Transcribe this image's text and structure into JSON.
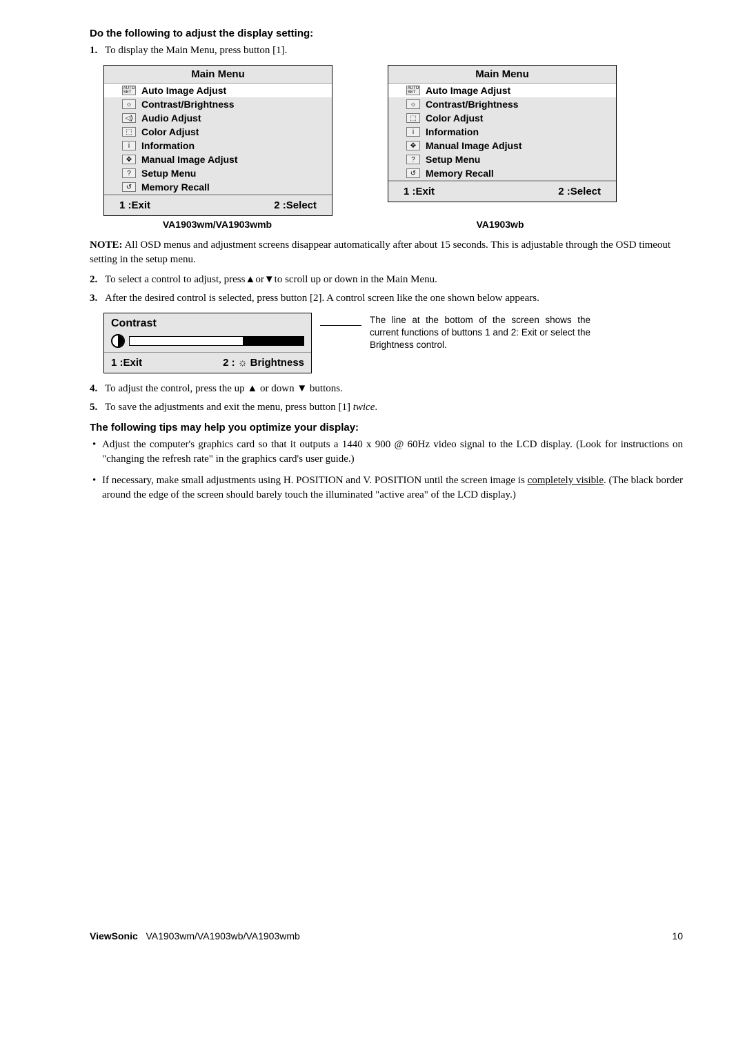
{
  "section1_title": "Do the following to adjust the display setting:",
  "step1": "To display the Main Menu, press button [1].",
  "left_menu": {
    "title": "Main Menu",
    "items": [
      {
        "icon": "AUTO SET",
        "label": "Auto Image Adjust",
        "selected": true
      },
      {
        "icon": "☼",
        "label": "Contrast/Brightness"
      },
      {
        "icon": "◁))",
        "label": "Audio Adjust"
      },
      {
        "icon": "⬚",
        "label": "Color Adjust"
      },
      {
        "icon": "i",
        "label": "Information"
      },
      {
        "icon": "✥",
        "label": "Manual Image Adjust"
      },
      {
        "icon": "?",
        "label": "Setup Menu"
      },
      {
        "icon": "↺",
        "label": "Memory Recall"
      }
    ],
    "footer_left": "1 :Exit",
    "footer_right": "2 :Select",
    "caption": "VA1903wm/VA1903wmb"
  },
  "right_menu": {
    "title": "Main Menu",
    "items": [
      {
        "icon": "AUTO SET",
        "label": "Auto Image Adjust",
        "selected": true
      },
      {
        "icon": "☼",
        "label": "Contrast/Brightness"
      },
      {
        "icon": "⬚",
        "label": "Color Adjust"
      },
      {
        "icon": "i",
        "label": "Information"
      },
      {
        "icon": "✥",
        "label": "Manual Image Adjust"
      },
      {
        "icon": "?",
        "label": "Setup Menu"
      },
      {
        "icon": "↺",
        "label": "Memory Recall"
      }
    ],
    "footer_left": "1 :Exit",
    "footer_right": "2 :Select",
    "caption": "VA1903wb"
  },
  "note_text": "All OSD menus and adjustment screens disappear automatically after about 15 seconds. This is adjustable through the OSD timeout setting in the setup menu.",
  "step2": "To select a control to adjust, press▲or▼to scroll up or down in the Main Menu.",
  "step3": "After the desired control is selected, press button [2]. A control screen like the one shown below appears.",
  "contrast": {
    "title": "Contrast",
    "footer_left": "1 :Exit",
    "footer_right": "2 : ☼ Brightness"
  },
  "side_note": "The line at the bottom of the screen shows the current functions of buttons 1 and 2: Exit or select the Brightness control.",
  "step4": "To adjust the control, press the up ▲ or down ▼ buttons.",
  "step5_pre": "To save the adjustments and exit the menu, press button [1] ",
  "step5_ital": "twice",
  "section2_title": "The following tips may help you optimize your display:",
  "tip1": "Adjust the computer's graphics card so that it outputs a 1440 x 900 @ 60Hz video signal to the LCD display. (Look for instructions on \"changing the refresh rate\" in the graphics card's user guide.)",
  "tip2_pre": "If necessary, make small adjustments using H. POSITION and V. POSITION until the screen image is ",
  "tip2_ul": "completely visible",
  "tip2_post": ". (The black border around the edge of the screen should barely touch the illuminated \"active area\" of the LCD display.)",
  "footer_brand": "ViewSonic",
  "footer_model": "VA1903wm/VA1903wb/VA1903wmb",
  "footer_page": "10"
}
